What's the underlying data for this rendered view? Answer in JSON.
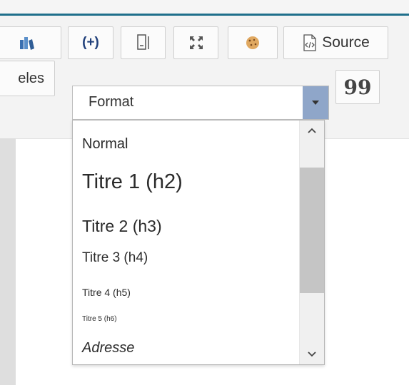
{
  "toolbar": {
    "row1": [
      {
        "name": "books-icon"
      },
      {
        "name": "placeholder-icon",
        "glyph": "(+)"
      },
      {
        "name": "text-field-icon"
      },
      {
        "name": "maximize-icon"
      },
      {
        "name": "cookie-icon"
      }
    ],
    "source_label": "Source",
    "models_label": "eles",
    "quote_glyph": "99"
  },
  "format": {
    "label": "Format",
    "options": [
      {
        "label": "Normal"
      },
      {
        "label": "Titre 1 (h2)"
      },
      {
        "label": "Titre 2 (h3)"
      },
      {
        "label": "Titre 3 (h4)"
      },
      {
        "label": "Titre 4 (h5)"
      },
      {
        "label": "Titre 5 (h6)"
      },
      {
        "label": "Adresse"
      }
    ]
  },
  "colors": {
    "accent_line": "#1f6f8b",
    "dropdown_arrow_bg": "#8fa6c9",
    "scroll_thumb": "#c5c5c5"
  }
}
